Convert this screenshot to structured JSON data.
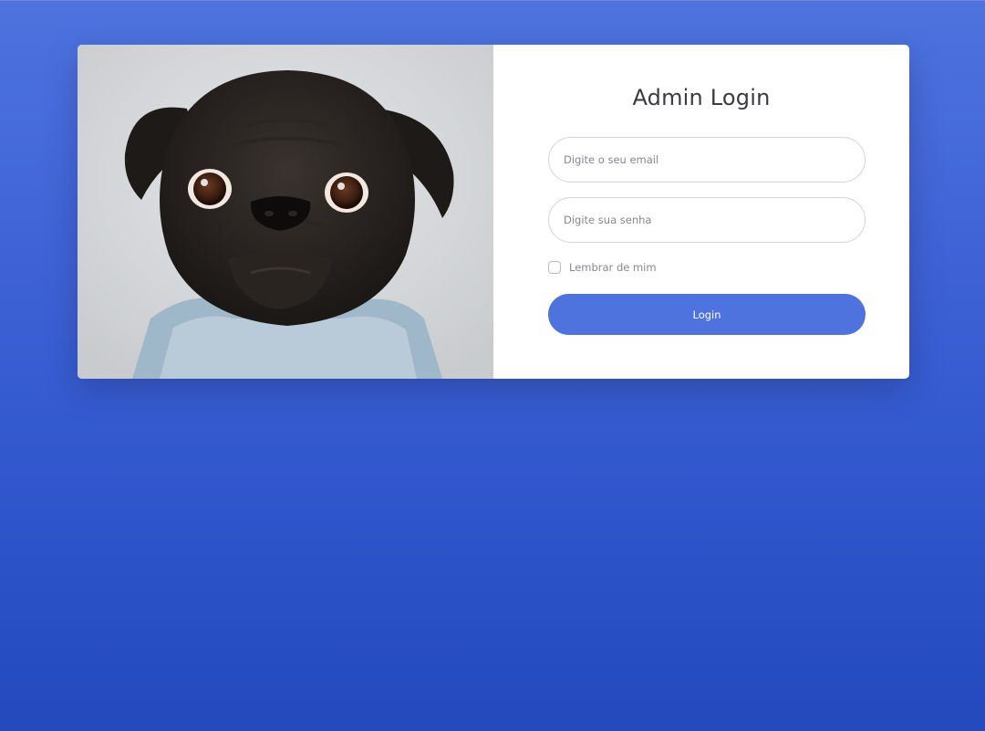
{
  "page": {
    "background_color": "#4e73df"
  },
  "login": {
    "title": "Admin Login",
    "email_placeholder": "Digite o seu email",
    "password_placeholder": "Digite sua senha",
    "remember_label": "Lembrar de mim",
    "button_label": "Login",
    "accent_color": "#4e73df"
  },
  "image": {
    "subject": "black pug wearing denim jacket"
  }
}
